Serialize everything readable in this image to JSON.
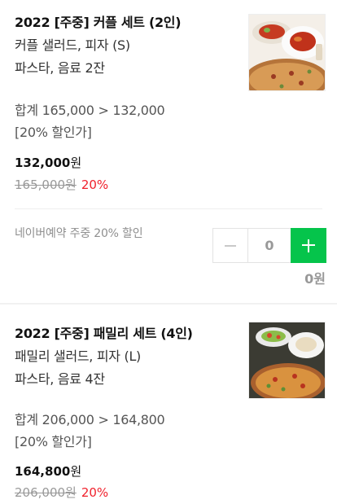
{
  "items": [
    {
      "title": "2022 [주중] 커플 세트 (2인)",
      "desc_line1": "커플 샐러드, 피자 (S)",
      "desc_line2": "파스타, 음료 2잔",
      "sum_line1": "합계 165,000 > 132,000",
      "sum_line2": "[20% 할인가]",
      "price": "132,000",
      "price_unit": "원",
      "original_price": "165,000원",
      "discount_rate": "20%",
      "naver_note": "네이버예약 주중 20% 할인",
      "quantity": "0",
      "line_total": "0원"
    },
    {
      "title": "2022 [주중] 패밀리 세트 (4인)",
      "desc_line1": "패밀리 샐러드, 피자 (L)",
      "desc_line2": "파스타, 음료 4잔",
      "sum_line1": "합계 206,000 > 164,800",
      "sum_line2": "[20% 할인가]",
      "price": "164,800",
      "price_unit": "원",
      "original_price": "206,000원",
      "discount_rate": "20%"
    }
  ],
  "colors": {
    "accent_green": "#05c44b",
    "discount_red": "#f0212c",
    "muted_gray": "#999999"
  },
  "icons": {
    "minus": "minus-icon",
    "plus": "plus-icon"
  }
}
